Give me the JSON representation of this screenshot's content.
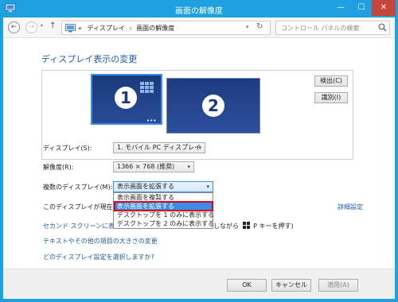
{
  "window": {
    "title": "画面の解像度",
    "minimize_glyph": "—",
    "maximize_glyph": "☐",
    "close_glyph": "✕"
  },
  "addressbar": {
    "back_glyph": "←",
    "forward_glyph": "→",
    "dropdown_glyph": "▾",
    "up_glyph": "↑",
    "path_prefix": "«",
    "path_parts": [
      "ディスプレイ",
      "画面の解像度"
    ],
    "path_separator": "›",
    "refresh_glyph": "↻",
    "search_placeholder": "コントロール パネルの検索"
  },
  "heading": "ディスプレイ表示の変更",
  "preview": {
    "monitors": [
      {
        "number": "1",
        "selected": true
      },
      {
        "number": "2",
        "selected": false
      }
    ],
    "dots": "•••",
    "detect_label": "検出(C)",
    "identify_label": "識別(I)"
  },
  "fields": {
    "display": {
      "label": "ディスプレイ(S):",
      "value": "1. モバイル PC ディスプレイ"
    },
    "resolution": {
      "label": "解像度(R):",
      "value": "1366 × 768 (推奨)"
    },
    "multiple": {
      "label": "複数のディスプレイ(M):",
      "value": "表示画面を拡張する"
    }
  },
  "select_arrow": "▾",
  "dropdown": {
    "items": [
      {
        "label": "表示画面を複製する",
        "selected": false
      },
      {
        "label": "表示画面を拡張する",
        "selected": true
      },
      {
        "label": "デスクトップを 1 のみに表示する",
        "selected": false
      },
      {
        "label": "デスクトップを 2 のみに表示する",
        "selected": false
      }
    ]
  },
  "main_display_label": "このディスプレイが現在メイ",
  "advanced_link": "詳細設定",
  "links": {
    "second_screen": "セカンド スクリーンに表示す",
    "second_screen_tail_before": "しながら",
    "second_screen_tail_after": "P キーを押す)",
    "text_size": "テキストやその他の項目の大きさの変更",
    "which_settings": "どのディスプレイ設定を選択しますか?"
  },
  "buttons": {
    "ok": "OK",
    "cancel": "キャンセル",
    "apply": "適用(A)"
  },
  "colors": {
    "titlebar": "#1ea1e0",
    "link": "#1e5aa8",
    "selection": "#3a8ee6",
    "highlight_border": "#e0001a",
    "close_button": "#c7463a"
  }
}
